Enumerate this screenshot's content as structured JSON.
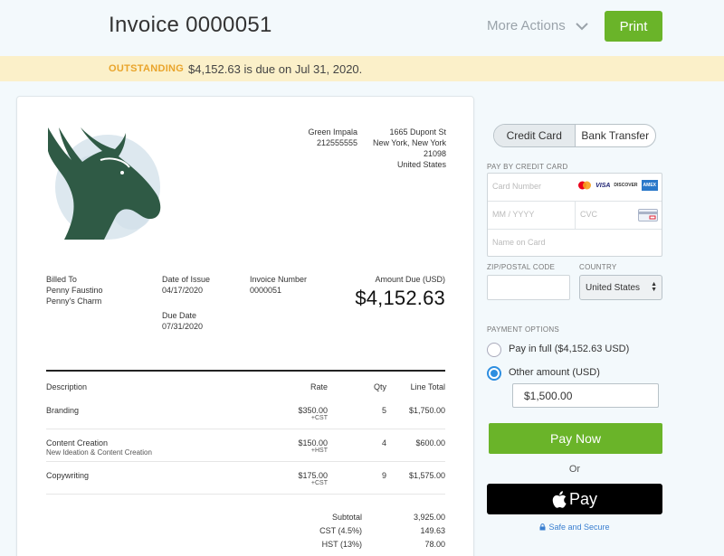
{
  "header": {
    "title": "Invoice 0000051",
    "more_actions": "More Actions",
    "print": "Print"
  },
  "banner": {
    "status": "OUTSTANDING",
    "message": "$4,152.63 is due on Jul 31, 2020."
  },
  "invoice": {
    "from_name": "Green Impala",
    "from_phone": "212555555",
    "address_line1": "1665 Dupont St",
    "address_line2": "New York, New York",
    "address_zip": "21098",
    "address_country": "United States",
    "billed_to_label": "Billed To",
    "billed_to_name": "Penny Faustino",
    "billed_to_company": "Penny's Charm",
    "date_of_issue_label": "Date of Issue",
    "date_of_issue": "04/17/2020",
    "invoice_number_label": "Invoice Number",
    "invoice_number": "0000051",
    "due_date_label": "Due Date",
    "due_date": "07/31/2020",
    "amount_due_label": "Amount Due (USD)",
    "amount_due": "$4,152.63",
    "columns": {
      "description": "Description",
      "rate": "Rate",
      "qty": "Qty",
      "line_total": "Line Total"
    },
    "items": [
      {
        "description": "Branding",
        "sub": "",
        "rate": "$350.00",
        "tax": "+CST",
        "qty": "5",
        "total": "$1,750.00"
      },
      {
        "description": "Content Creation",
        "sub": "New Ideation & Content Creation",
        "rate": "$150.00",
        "tax": "+HST",
        "qty": "4",
        "total": "$600.00"
      },
      {
        "description": "Copywriting",
        "sub": "",
        "rate": "$175.00",
        "tax": "+CST",
        "qty": "9",
        "total": "$1,575.00"
      }
    ],
    "totals": [
      {
        "label": "Subtotal",
        "value": "3,925.00"
      },
      {
        "label": "CST (4.5%)",
        "value": "149.63"
      },
      {
        "label": "HST (13%)",
        "value": "78.00"
      }
    ]
  },
  "payment": {
    "tab_credit_card": "Credit Card",
    "tab_bank_transfer": "Bank Transfer",
    "pay_by_card_label": "PAY BY CREDIT CARD",
    "card_number_placeholder": "Card Number",
    "expiry_placeholder": "MM / YYYY",
    "cvc_placeholder": "CVC",
    "name_placeholder": "Name on Card",
    "brand_visa": "VISA",
    "brand_discover": "DISCOVER",
    "brand_amex": "AMEX",
    "zip_label": "ZIP/POSTAL CODE",
    "country_label": "COUNTRY",
    "country_value": "United States",
    "payment_options_label": "PAYMENT OPTIONS",
    "pay_in_full": "Pay in full ($4,152.63 USD)",
    "other_amount": "Other amount (USD)",
    "other_amount_value": "$1,500.00",
    "pay_now": "Pay Now",
    "or": "Or",
    "apple_pay": "Pay",
    "secure": "Safe and Secure"
  },
  "colors": {
    "accent_green": "#6ab429",
    "banner_bg": "#fbf0c9",
    "status_orange": "#e9a42b",
    "radio_blue": "#2d8ee0",
    "logo_green": "#2f5a45"
  }
}
